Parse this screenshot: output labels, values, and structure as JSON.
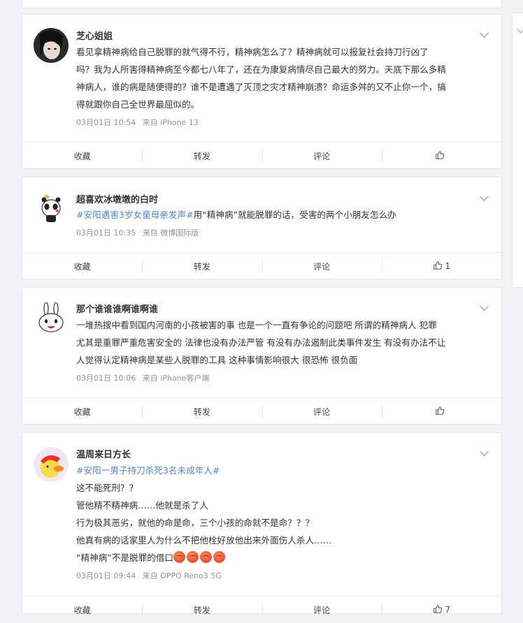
{
  "comments": [
    {
      "name": "芝心姐姐",
      "lines": [
        "看见拿精神病给自己脱罪的就气得不行，精神病怎么了？精神病就可以报复社会持刀行凶了",
        "吗？我为人所害得精神病至今都七八年了，还在为康复病情尽自己最大的努力。天底下那么多精",
        "神病人，谁的病是随便得的？谁不是遭遇了灭顶之灾才精神崩溃？命运多舛的又不止你一个，搞",
        "得就跟你自己全世界最屈似的。"
      ],
      "time": "03月01日 10:54",
      "source": "来自 iPhone 13",
      "likes": ""
    },
    {
      "name": "超喜欢冰墩墩的白时",
      "lines": [
        "#安阳遇害3岁女童母亲发声#用“精神病”就能脱罪的话，受害的两个小朋友怎么办"
      ],
      "time": "03月01日 10:35",
      "source": "来自 微博国际版",
      "likes": "1"
    },
    {
      "name": "那个谁谁谁啊谁啊谁",
      "lines": [
        "一堆热搜中看到国内河南的小孩被害的事 也是一个一直有争论的问题吧 所谓的精神病人 犯罪",
        "尤其是重罪严重危害安全的 法律也没有办法严管 有没有办法遏制此类事件发生 有没有办法不让",
        "人觉得认定精神病是某些人脱罪的工具 这种事情影响很大 很恐怖 很负面"
      ],
      "time": "03月01日 10:06",
      "source": "来自 iPhone客户端",
      "likes": ""
    },
    {
      "name": "温周来日方长",
      "topic": "#安阳一男子持刀杀死3名未成年人#",
      "lines": [
        "这不能死刑？？",
        "管他精不精神病……他就是杀了人",
        "行为极其恶劣，就他的命是命，三个小孩的命就不是命？？？",
        "他真有病的话家里人为什么不把他栓好放他出来外面伤人杀人……",
        "“精神病”不是脱罪的借口"
      ],
      "time": "03月01日 09:44",
      "source": "来自 OPPO Reno3 5G",
      "likes": "7"
    }
  ],
  "actions": {
    "collect": "收藏",
    "repost": "转发",
    "comment": "评论"
  },
  "icons": {
    "like": "thumbs-up-icon",
    "more": "chevron-down-icon",
    "emoji": "angry-face-emoji"
  },
  "colors": {
    "topic": "#5286c6",
    "meta": "#939393",
    "background": "#f2f2f5"
  }
}
